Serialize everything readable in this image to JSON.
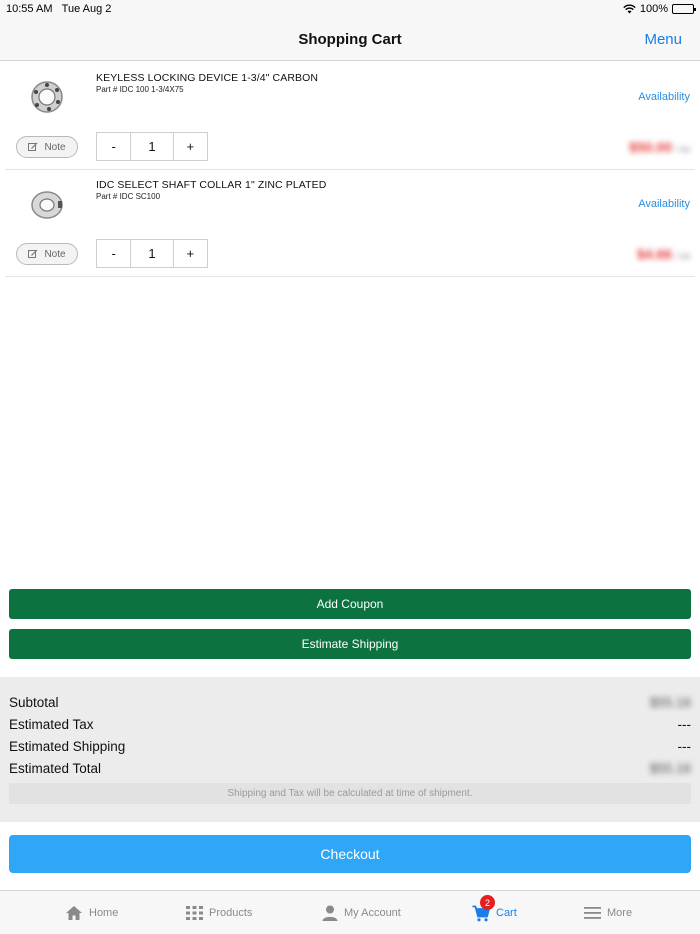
{
  "status": {
    "time": "10:55 AM",
    "date": "Tue Aug 2",
    "battery": "100%"
  },
  "nav": {
    "title": "Shopping Cart",
    "menu": "Menu"
  },
  "items": [
    {
      "name": "KEYLESS LOCKING DEVICE 1-3/4\" CARBON",
      "part": "Part # IDC 100 1-3/4X75",
      "availability": "Availability",
      "note": "Note",
      "minus": "-",
      "qty": "1",
      "plus": "+",
      "price": "$50.00",
      "price_unit": "/ ea"
    },
    {
      "name": "IDC SELECT SHAFT COLLAR 1\" ZINC PLATED",
      "part": "Part # IDC SC100",
      "availability": "Availability",
      "note": "Note",
      "minus": "-",
      "qty": "1",
      "plus": "+",
      "price": "$4.66",
      "price_unit": "/ ea"
    }
  ],
  "buttons": {
    "coupon": "Add Coupon",
    "shipping": "Estimate Shipping",
    "checkout": "Checkout"
  },
  "summary": {
    "subtotal_label": "Subtotal",
    "subtotal": "$55.16",
    "tax_label": "Estimated Tax",
    "tax": "---",
    "shipping_label": "Estimated Shipping",
    "shipping": "---",
    "total_label": "Estimated Total",
    "total": "$55.16",
    "note": "Shipping and Tax will be calculated at time of shipment."
  },
  "tabs": {
    "home": "Home",
    "products": "Products",
    "account": "My Account",
    "cart": "Cart",
    "cart_badge": "2",
    "more": "More"
  },
  "colors": {
    "accent": "#1a7ee8",
    "green": "#0b7240",
    "checkout": "#2fa6f6",
    "badge": "#e81d1d"
  }
}
